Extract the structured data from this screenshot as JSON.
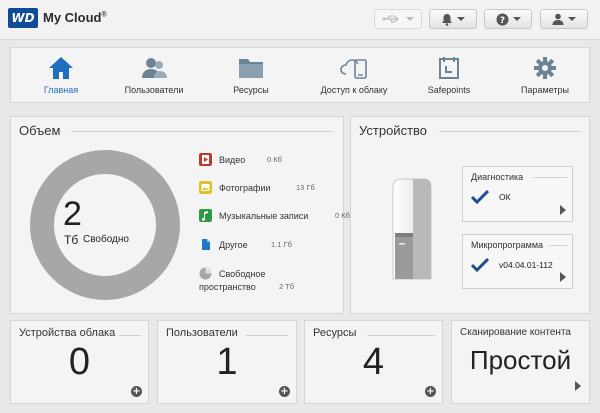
{
  "header": {
    "logo": "WD",
    "brand": "My Cloud",
    "brand_mark": "®"
  },
  "nav": [
    {
      "label": "Главная",
      "icon": "home-icon",
      "active": true
    },
    {
      "label": "Пользователи",
      "icon": "users-icon"
    },
    {
      "label": "Ресурсы",
      "icon": "folder-icon"
    },
    {
      "label": "Доступ к облаку",
      "icon": "cloud-device-icon"
    },
    {
      "label": "Safepoints",
      "icon": "safepoint-icon"
    },
    {
      "label": "Параметры",
      "icon": "gear-icon"
    }
  ],
  "volume": {
    "title": "Объем",
    "free_value": "2",
    "free_unit": "Тб",
    "free_label": "Свободно",
    "chart_data": {
      "type": "pie",
      "categories": [
        "Видео",
        "Фотографии",
        "Музыкальные записи",
        "Другое",
        "Свободное пространство"
      ],
      "values": [
        0,
        13,
        0,
        1.1,
        2000
      ],
      "units": [
        "Кб",
        "Гб",
        "Кб",
        "Гб",
        "Тб"
      ],
      "colors": [
        "#c0392b",
        "#e2c02a",
        "#2e9a48",
        "#1f78c8",
        "#a5a8a4"
      ]
    },
    "legend": [
      {
        "label": "Видео",
        "value": "0 Кб",
        "color": "#c0392b",
        "icon": "film-icon"
      },
      {
        "label": "Фотографии",
        "value": "13 Гб",
        "color": "#e2c02a",
        "icon": "photo-icon"
      },
      {
        "label": "Музыкальные записи",
        "value": "0 Кб",
        "color": "#2e9a48",
        "icon": "music-icon"
      },
      {
        "label": "Другое",
        "value": "1.1 Гб",
        "color": "#1f78c8",
        "icon": "document-icon"
      },
      {
        "label": "Свободное",
        "label2": "пространство",
        "value": "2 Тб",
        "color": "#a5a8a4",
        "icon": "free-space-icon"
      }
    ]
  },
  "device": {
    "title": "Устройство",
    "diagnostics": {
      "title": "Диагностика",
      "value": "ОК"
    },
    "firmware": {
      "title": "Микропрограмма",
      "value": "v04.04.01-112"
    }
  },
  "bottom": [
    {
      "title": "Устройства облака",
      "value": "0"
    },
    {
      "title": "Пользователи",
      "value": "1"
    },
    {
      "title": "Ресурсы",
      "value": "4"
    },
    {
      "title": "Сканирование контента",
      "value": "Простой"
    }
  ]
}
